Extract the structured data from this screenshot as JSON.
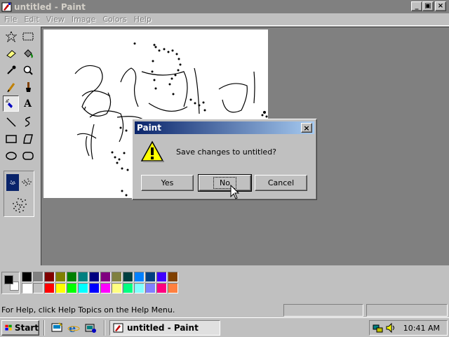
{
  "window": {
    "title": "untitled - Paint",
    "minimize_glyph": "_",
    "maximize_glyph": "▣",
    "close_glyph": "×"
  },
  "menu": [
    "File",
    "Edit",
    "View",
    "Image",
    "Colors",
    "Help"
  ],
  "tools": [
    {
      "name": "free-form-select",
      "icon": "star-select-icon"
    },
    {
      "name": "select",
      "icon": "rect-select-icon"
    },
    {
      "name": "eraser",
      "icon": "eraser-icon"
    },
    {
      "name": "fill-with-color",
      "icon": "paint-bucket-icon"
    },
    {
      "name": "pick-color",
      "icon": "eyedropper-icon"
    },
    {
      "name": "magnifier",
      "icon": "magnifier-icon"
    },
    {
      "name": "pencil",
      "icon": "pencil-icon"
    },
    {
      "name": "brush",
      "icon": "brush-icon"
    },
    {
      "name": "airbrush",
      "icon": "airbrush-icon",
      "active": true
    },
    {
      "name": "text",
      "icon": "text-icon",
      "label": "A"
    },
    {
      "name": "line",
      "icon": "line-icon"
    },
    {
      "name": "curve",
      "icon": "curve-icon"
    },
    {
      "name": "rectangle",
      "icon": "rectangle-icon"
    },
    {
      "name": "polygon",
      "icon": "polygon-icon"
    },
    {
      "name": "ellipse",
      "icon": "ellipse-icon"
    },
    {
      "name": "rounded-rectangle",
      "icon": "rounded-rect-icon"
    }
  ],
  "palette": {
    "foreground": "#000000",
    "background": "#ffffff",
    "row1": [
      "#000000",
      "#808080",
      "#800000",
      "#808000",
      "#008000",
      "#008080",
      "#000080",
      "#800080",
      "#808040",
      "#004040",
      "#0080ff",
      "#004080",
      "#4000ff",
      "#804000"
    ],
    "row2": [
      "#ffffff",
      "#c0c0c0",
      "#ff0000",
      "#ffff00",
      "#00ff00",
      "#00ffff",
      "#0000ff",
      "#ff00ff",
      "#ffff80",
      "#00ff80",
      "#80ffff",
      "#8080ff",
      "#ff0080",
      "#ff8040"
    ]
  },
  "status": {
    "help_text": "For Help, click Help Topics on the Help Menu."
  },
  "dialog": {
    "title": "Paint",
    "message": "Save changes to untitled?",
    "icon": "warning-icon",
    "buttons": {
      "yes": "Yes",
      "no": "No",
      "cancel": "Cancel"
    },
    "close_glyph": "×"
  },
  "taskbar": {
    "start_label": "Start",
    "task_label": "untitled - Paint",
    "clock": "10:41 AM"
  }
}
